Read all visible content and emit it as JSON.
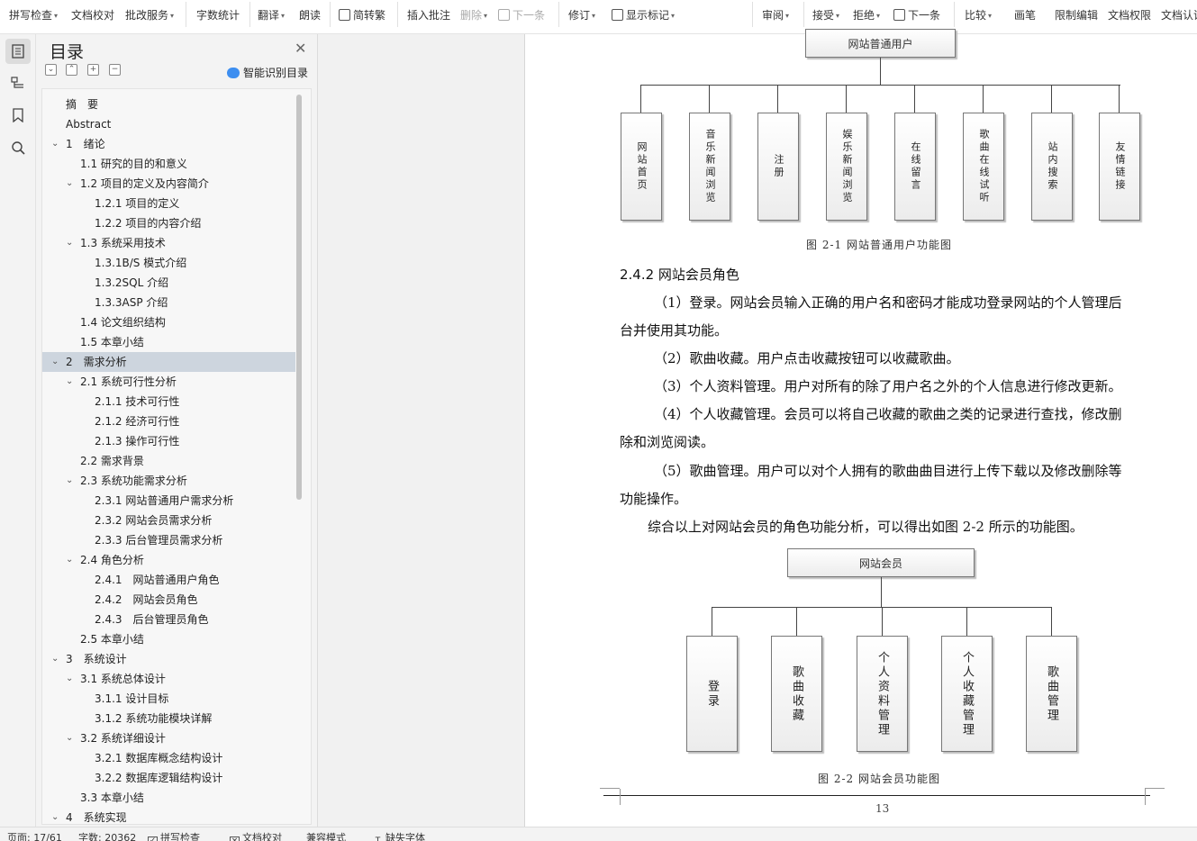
{
  "ribbon": {
    "items": [
      {
        "label": "拼写检查",
        "caret": true
      },
      {
        "label": "文档校对",
        "caret": false
      },
      {
        "label": "批改服务",
        "caret": true
      },
      {
        "label": "字数统计",
        "caret": false
      },
      {
        "label": "翻译",
        "caret": true
      },
      {
        "label": "朗读",
        "caret": false
      },
      {
        "label": "简转繁",
        "caret": false
      },
      {
        "label": "插入批注",
        "caret": false
      },
      {
        "label": "删除",
        "caret": true
      },
      {
        "label": "下一条",
        "caret": false
      },
      {
        "label": "修订",
        "caret": true
      },
      {
        "label": "显示标记",
        "caret": true
      },
      {
        "label": "审阅",
        "caret": true
      },
      {
        "label": "接受",
        "caret": true
      },
      {
        "label": "拒绝",
        "caret": true
      },
      {
        "label": "下一条",
        "caret": false
      },
      {
        "label": "比较",
        "caret": true
      },
      {
        "label": "画笔",
        "caret": false
      },
      {
        "label": "限制编辑",
        "caret": false
      },
      {
        "label": "文档权限",
        "caret": false
      },
      {
        "label": "文档认证",
        "caret": false
      }
    ]
  },
  "toc": {
    "title": "目录",
    "smart_label": "智能识别目录",
    "items": [
      {
        "text": "摘　要",
        "level": 1,
        "chevron": false
      },
      {
        "text": "Abstract",
        "level": 1,
        "chevron": false
      },
      {
        "text": "1　绪论",
        "level": 1,
        "chevron": true
      },
      {
        "text": "1.1 研究的目的和意义",
        "level": 2,
        "chevron": false
      },
      {
        "text": "1.2 项目的定义及内容简介",
        "level": 2,
        "chevron": true
      },
      {
        "text": "1.2.1 项目的定义",
        "level": 3,
        "chevron": false
      },
      {
        "text": "1.2.2 项目的内容介绍",
        "level": 3,
        "chevron": false
      },
      {
        "text": "1.3 系统采用技术",
        "level": 2,
        "chevron": true
      },
      {
        "text": "1.3.1B/S 模式介绍",
        "level": 3,
        "chevron": false
      },
      {
        "text": "1.3.2SQL 介绍",
        "level": 3,
        "chevron": false
      },
      {
        "text": "1.3.3ASP 介绍",
        "level": 3,
        "chevron": false
      },
      {
        "text": "1.4 论文组织结构",
        "level": 2,
        "chevron": false
      },
      {
        "text": "1.5 本章小结",
        "level": 2,
        "chevron": false
      },
      {
        "text": "2　需求分析",
        "level": 1,
        "chevron": true,
        "selected": true
      },
      {
        "text": "2.1 系统可行性分析",
        "level": 2,
        "chevron": true
      },
      {
        "text": "2.1.1 技术可行性",
        "level": 3,
        "chevron": false
      },
      {
        "text": "2.1.2 经济可行性",
        "level": 3,
        "chevron": false
      },
      {
        "text": "2.1.3 操作可行性",
        "level": 3,
        "chevron": false
      },
      {
        "text": "2.2 需求背景",
        "level": 2,
        "chevron": false
      },
      {
        "text": "2.3 系统功能需求分析",
        "level": 2,
        "chevron": true
      },
      {
        "text": "2.3.1 网站普通用户需求分析",
        "level": 3,
        "chevron": false
      },
      {
        "text": "2.3.2 网站会员需求分析",
        "level": 3,
        "chevron": false
      },
      {
        "text": "2.3.3 后台管理员需求分析",
        "level": 3,
        "chevron": false
      },
      {
        "text": "2.4 角色分析",
        "level": 2,
        "chevron": true
      },
      {
        "text": "2.4.1　网站普通用户角色",
        "level": 3,
        "chevron": false
      },
      {
        "text": "2.4.2　网站会员角色",
        "level": 3,
        "chevron": false
      },
      {
        "text": "2.4.3　后台管理员角色",
        "level": 3,
        "chevron": false
      },
      {
        "text": "2.5 本章小结",
        "level": 2,
        "chevron": false
      },
      {
        "text": "3　系统设计",
        "level": 1,
        "chevron": true
      },
      {
        "text": "3.1 系统总体设计",
        "level": 2,
        "chevron": true
      },
      {
        "text": "3.1.1 设计目标",
        "level": 3,
        "chevron": false
      },
      {
        "text": "3.1.2 系统功能模块详解",
        "level": 3,
        "chevron": false
      },
      {
        "text": "3.2 系统详细设计",
        "level": 2,
        "chevron": true
      },
      {
        "text": "3.2.1 数据库概念结构设计",
        "level": 3,
        "chevron": false
      },
      {
        "text": "3.2.2 数据库逻辑结构设计",
        "level": 3,
        "chevron": false
      },
      {
        "text": "3.3 本章小结",
        "level": 2,
        "chevron": false
      },
      {
        "text": "4　系统实现",
        "level": 1,
        "chevron": true
      }
    ]
  },
  "document": {
    "fig1": {
      "root": "网站普通用户",
      "children": [
        "网站首页",
        "音乐新闻浏览",
        "注册",
        "娱乐新闻浏览",
        "在线留言",
        "歌曲在线试听",
        "站内搜索",
        "友情链接"
      ],
      "caption": "图 2-1 网站普通用户功能图"
    },
    "section_heading": "2.4.2 网站会员角色",
    "paragraphs": [
      "（1）登录。网站会员输入正确的用户名和密码才能成功登录网站的个人管理后",
      "台并使用其功能。",
      "（2）歌曲收藏。用户点击收藏按钮可以收藏歌曲。",
      "（3）个人资料管理。用户对所有的除了用户名之外的个人信息进行修改更新。",
      "（4）个人收藏管理。会员可以将自己收藏的歌曲之类的记录进行查找，修改删",
      "除和浏览阅读。",
      "（5）歌曲管理。用户可以对个人拥有的歌曲曲目进行上传下载以及修改删除等",
      "功能操作。",
      "综合以上对网站会员的角色功能分析，可以得出如图 2-2 所示的功能图。"
    ],
    "fig2": {
      "root": "网站会员",
      "children": [
        "登录",
        "歌曲收藏",
        "个人资料管理",
        "个人收藏管理",
        "歌曲管理"
      ],
      "caption": "图 2-2 网站会员功能图"
    },
    "page_number": "13"
  },
  "status": {
    "page": "页面: 17/61",
    "words": "字数: 20362",
    "spell": "拼写检查",
    "proof": "文档校对",
    "compat": "兼容模式",
    "font": "缺失字体"
  }
}
